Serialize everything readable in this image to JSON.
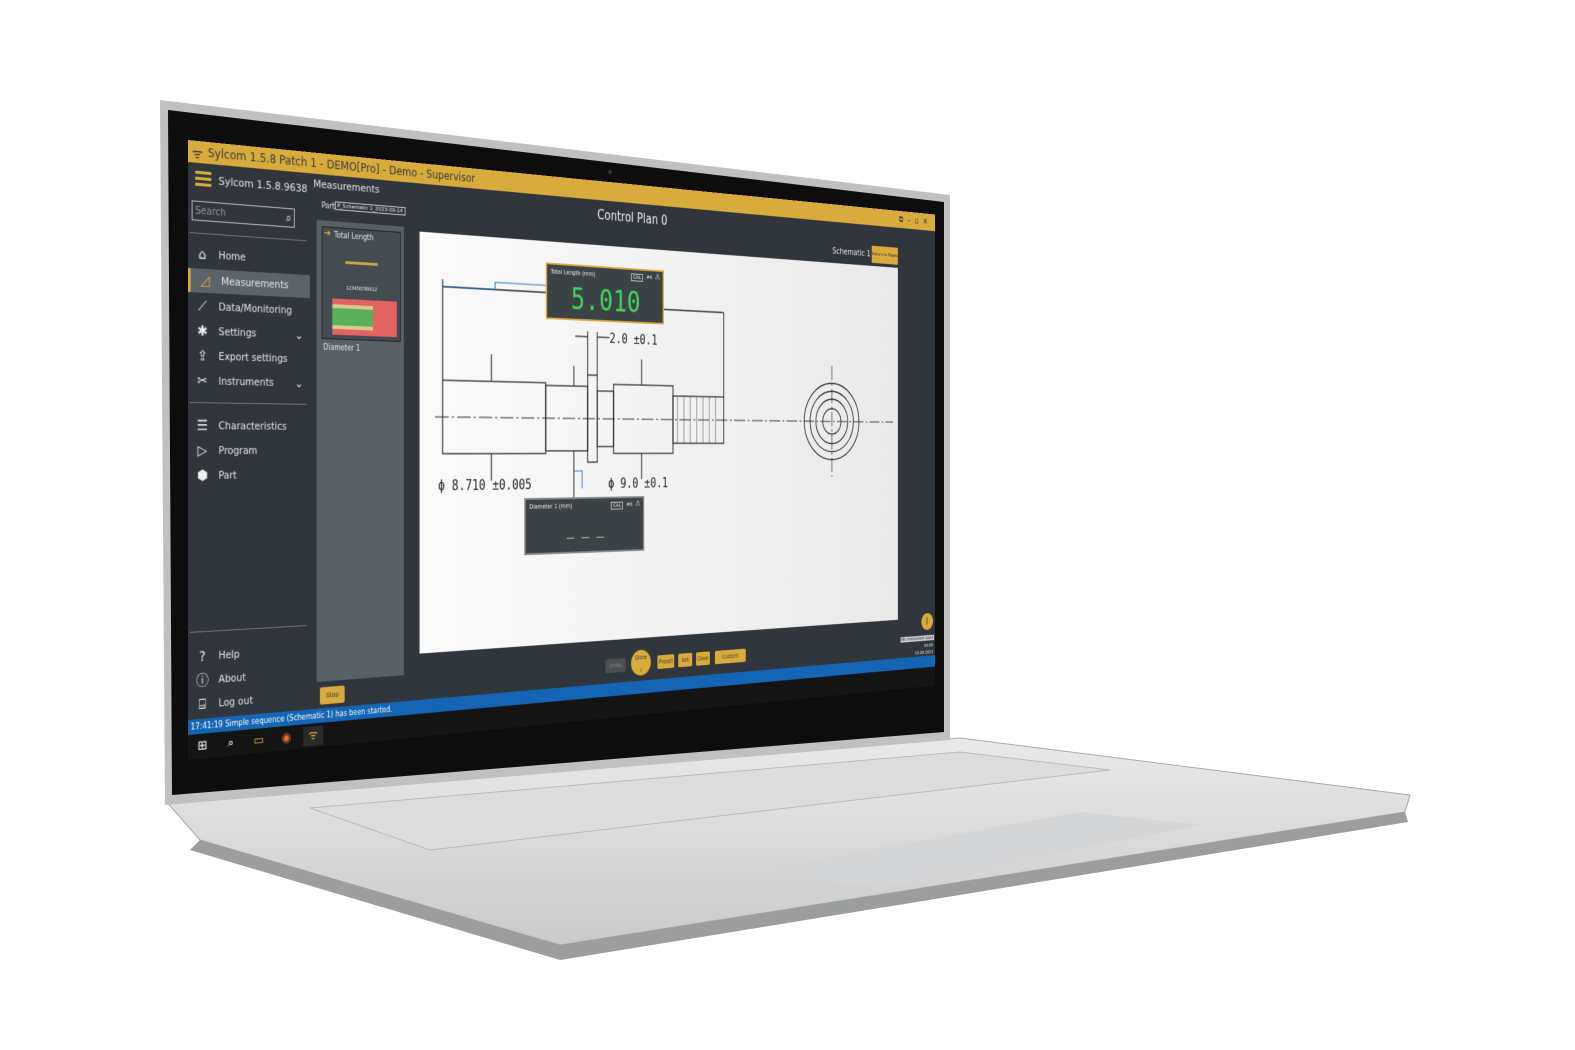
{
  "window": {
    "title": "Sylcom 1.5.8 Patch 1 - DEMO[Pro] - Demo - Supervisor",
    "controls": [
      "restore",
      "minimize",
      "maximize",
      "close"
    ]
  },
  "sidebar": {
    "app_version": "Sylcom 1.5.8.9638 - I",
    "search_placeholder": "Search",
    "items": [
      {
        "label": "Home",
        "icon": "home-icon"
      },
      {
        "label": "Measurements",
        "icon": "set-square-icon",
        "active": true
      },
      {
        "label": "Data/Monitoring",
        "icon": "chart-icon"
      },
      {
        "label": "Settings",
        "icon": "gears-icon",
        "expandable": true
      },
      {
        "label": "Export settings",
        "icon": "export-icon"
      },
      {
        "label": "Instruments",
        "icon": "tools-icon",
        "expandable": true
      }
    ],
    "items2": [
      {
        "label": "Characteristics",
        "icon": "list-icon"
      },
      {
        "label": "Program",
        "icon": "program-icon"
      },
      {
        "label": "Part",
        "icon": "hexagon-icon"
      }
    ],
    "footer": [
      {
        "label": "Help",
        "icon": "question-icon"
      },
      {
        "label": "About",
        "icon": "info-icon"
      },
      {
        "label": "Log out",
        "icon": "logout-icon"
      }
    ]
  },
  "page": {
    "title": "Measurements",
    "part_label": "Part",
    "part_value": "P_Schematic 1_2023-09-14",
    "thumbs": {
      "card_title": "Total Length",
      "serial": "123456789012",
      "spc_axis": "5",
      "next": "Diameter 1"
    },
    "control_plan": "Control Plan 0",
    "schematic": "Schematic 1",
    "return_button": "Return to Pages"
  },
  "measurements": [
    {
      "label": "Total Length  (mm)",
      "cal": "CAL",
      "index": "#6",
      "value": "5.010",
      "value_color": "#3fd45a"
    },
    {
      "label": "Diameter 1  (mm)",
      "cal": "CAL",
      "index": "#6",
      "value": "_  _  _",
      "value_color": "#e8e8e8"
    }
  ],
  "drawing": {
    "dims": [
      "2.0 ±0.1",
      "ϕ 8.710 ±0.005",
      "ϕ 9.0 ±0.1"
    ]
  },
  "toolbar": {
    "stop": "Stop",
    "undo": "Undo",
    "store": "Store",
    "preset": "Preset",
    "set": "Set",
    "clear": "Clear",
    "custom_preset": "Custom Preset",
    "instrument": "No instrument used",
    "time": "09:06",
    "date": "19.09.2023"
  },
  "status": {
    "message": "17:41:19 Simple sequence (Schematic 1) has been started."
  },
  "taskbar": {
    "items": [
      "windows-icon",
      "search-icon",
      "file-explorer-icon",
      "firefox-icon",
      "sylcom-icon"
    ]
  },
  "colors": {
    "accent": "#d8ab3c",
    "status_bar": "#1565b5",
    "panel": "#30363b",
    "value_green": "#3fd45a"
  }
}
